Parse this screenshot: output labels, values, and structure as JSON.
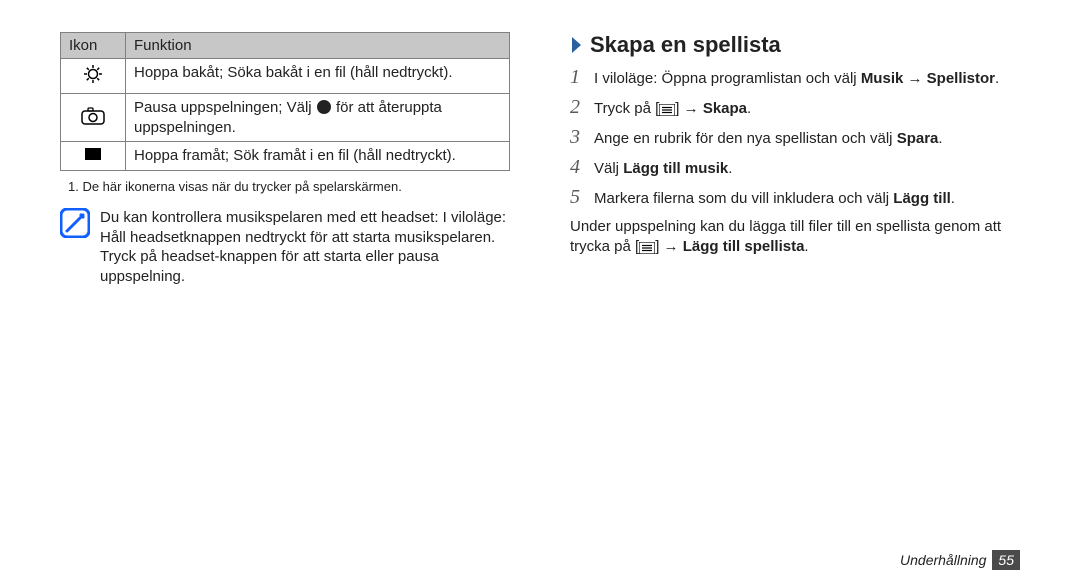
{
  "table": {
    "head_icon": "Ikon",
    "head_func": "Funktion",
    "rows": [
      {
        "func": "Hoppa bakåt; Söka bakåt i en fil (håll nedtryckt)."
      },
      {
        "func_pre": "Pausa uppspelningen; Välj ",
        "func_post": " för att återuppta uppspelningen."
      },
      {
        "func": "Hoppa framåt; Sök framåt i en fil (håll nedtryckt)."
      }
    ]
  },
  "footnote": "1. De här ikonerna visas när du trycker på spelarskärmen.",
  "note": "Du kan kontrollera musikspelaren med ett headset: I viloläge: Håll headsetknappen nedtryckt för att starta musikspelaren. Tryck på headset-knappen för att starta eller pausa uppspelning.",
  "section_title": "Skapa en spellista",
  "steps": [
    {
      "n": "1",
      "plain1": "I viloläge: Öppna programlistan och välj ",
      "b1": "Musik",
      "arrow1": " → ",
      "b2": "Spellistor",
      "tail": "."
    },
    {
      "n": "2",
      "plain1": "Tryck på [",
      "menu_icon": true,
      "plain2": "] → ",
      "b1": "Skapa",
      "tail": "."
    },
    {
      "n": "3",
      "plain1": "Ange en rubrik för den nya spellistan och välj ",
      "b1": "Spara",
      "tail": "."
    },
    {
      "n": "4",
      "plain1": "Välj ",
      "b1": "Lägg till musik",
      "tail": "."
    },
    {
      "n": "5",
      "plain1": "Markera filerna som du vill inkludera och välj ",
      "b1": "Lägg till",
      "tail": "."
    }
  ],
  "after_steps": {
    "p1": "Under uppspelning kan du lägga till filer till en spellista genom att trycka på [",
    "p2": "] → ",
    "b": "Lägg till spellista",
    "tail": "."
  },
  "footer_cat": "Underhållning",
  "footer_page": "55"
}
